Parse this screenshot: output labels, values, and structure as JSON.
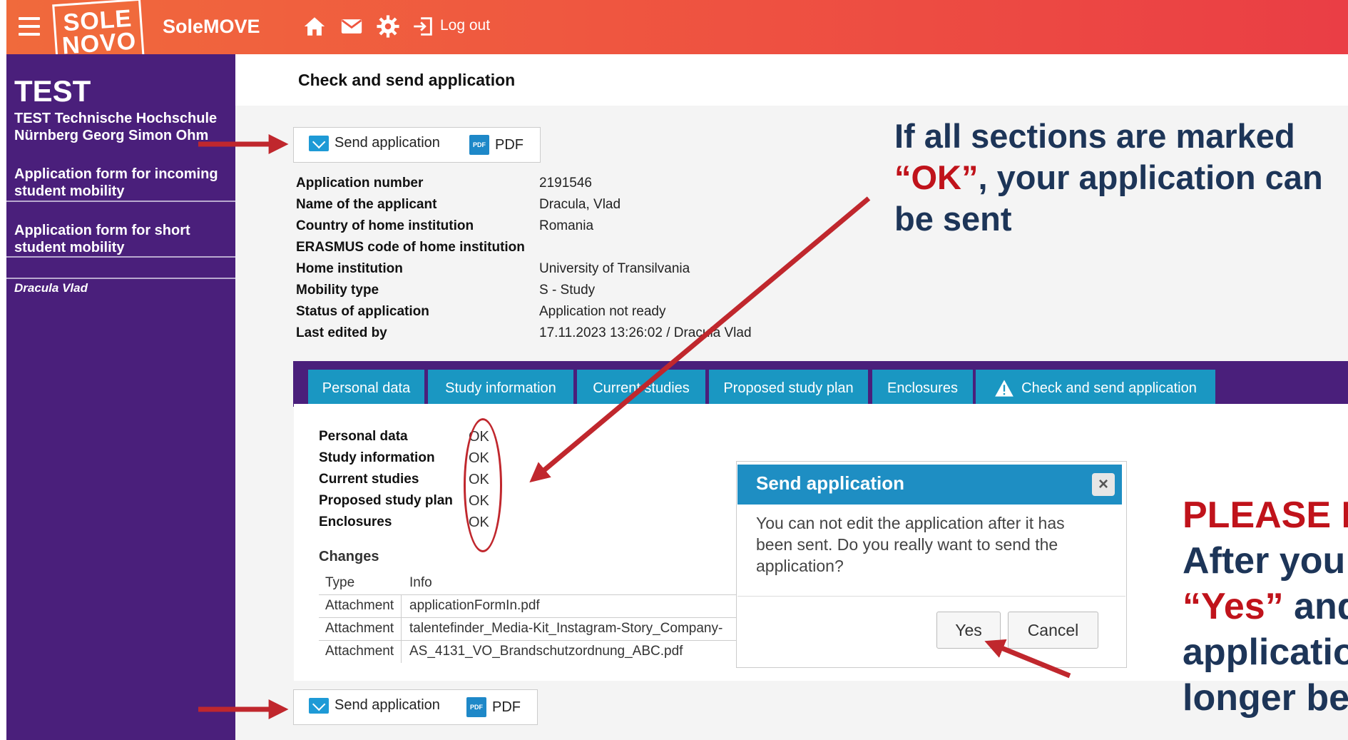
{
  "header": {
    "logo_line1": "SOLE",
    "logo_line2": "NOVO",
    "app_name": "SoleMOVE",
    "logout_label": "Log out"
  },
  "sidebar": {
    "title": "TEST",
    "institution_line1": "TEST Technische Hochschule",
    "institution_line2": "Nürnberg Georg Simon Ohm",
    "items": [
      {
        "line1": "Application form for incoming",
        "line2": "student mobility"
      },
      {
        "line1": "Application form for short",
        "line2": "student mobility"
      }
    ],
    "user": "Dracula Vlad"
  },
  "main": {
    "page_title": "Check and send application",
    "send_label": "Send application",
    "pdf_label": "PDF",
    "info": [
      {
        "label": "Application number",
        "value": "2191546"
      },
      {
        "label": "Name of the applicant",
        "value": "Dracula, Vlad"
      },
      {
        "label": "Country of home institution",
        "value": "Romania"
      },
      {
        "label": "ERASMUS code of home institution",
        "value": ""
      },
      {
        "label": "Home institution",
        "value": "University of Transilvania"
      },
      {
        "label": "Mobility type",
        "value": "S - Study"
      },
      {
        "label": "Status of application",
        "value": "Application not ready"
      },
      {
        "label": "Last edited by",
        "value": "17.11.2023 13:26:02 / Dracula Vlad"
      }
    ],
    "tabs": [
      "Personal data",
      "Study information",
      "Current studies",
      "Proposed study plan",
      "Enclosures",
      "Check and send application"
    ],
    "sections": [
      {
        "label": "Personal data",
        "status": "OK"
      },
      {
        "label": "Study information",
        "status": "OK"
      },
      {
        "label": "Current studies",
        "status": "OK"
      },
      {
        "label": "Proposed study plan",
        "status": "OK"
      },
      {
        "label": "Enclosures",
        "status": "OK"
      }
    ],
    "changes": {
      "title": "Changes",
      "headers": [
        "Type",
        "Info"
      ],
      "rows": [
        [
          "Attachment",
          "applicationFormIn.pdf"
        ],
        [
          "Attachment",
          "talentefinder_Media-Kit_Instagram-Story_Company-"
        ],
        [
          "Attachment",
          "AS_4131_VO_Brandschutzordnung_ABC.pdf"
        ]
      ]
    }
  },
  "dialog": {
    "title": "Send application",
    "message": "You can not edit the application after it has been sent. Do you really want to send the application?",
    "yes_label": "Yes",
    "cancel_label": "Cancel"
  },
  "annotations": {
    "note1_part1": "If all sections are marked",
    "note1_ok": "“OK”",
    "note1_part2": ", your application can",
    "note1_part3": "be sent",
    "note2_line1": "PLEASE N",
    "note2_line2": "After you",
    "note2_yes": "“Yes”",
    "note2_line3": " and",
    "note2_line4": "applicatio",
    "note2_line5": "longer be"
  },
  "colors": {
    "topbar": "#ef5640",
    "sidebar": "#4a1f7b",
    "tab": "#1a97c2",
    "dialog_header": "#1e8ec3",
    "annotation_red": "#c0131b",
    "annotation_navy": "#1d3558"
  }
}
